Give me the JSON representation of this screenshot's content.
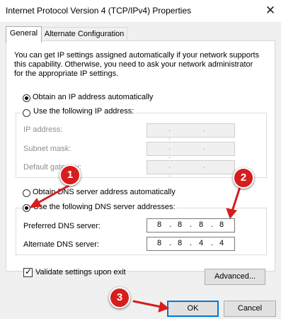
{
  "window": {
    "title": "Internet Protocol Version 4 (TCP/IPv4) Properties",
    "close_glyph": "✕"
  },
  "tabs": [
    {
      "label": "General",
      "active": true
    },
    {
      "label": "Alternate Configuration",
      "active": false
    }
  ],
  "intro_text": [
    "You can get IP settings assigned automatically if your network supports",
    "this capability. Otherwise, you need to ask your network administrator",
    "for the appropriate IP settings."
  ],
  "ip": {
    "auto_label": "Obtain an IP address automatically",
    "auto_selected": true,
    "manual_label": "Use the following IP address:",
    "manual_selected": false,
    "fields": [
      {
        "label": "IP address:",
        "value": ". . ."
      },
      {
        "label": "Subnet mask:",
        "value": ". . ."
      },
      {
        "label": "Default gateway:",
        "value": ". . ."
      }
    ]
  },
  "dns": {
    "auto_label": "Obtain DNS server address automatically",
    "auto_selected": false,
    "manual_label": "Use the following DNS server addresses:",
    "manual_selected": true,
    "preferred": {
      "label": "Preferred DNS server:",
      "octets": [
        "8",
        "8",
        "8",
        "8"
      ]
    },
    "alternate": {
      "label": "Alternate DNS server:",
      "octets": [
        "8",
        "8",
        "4",
        "4"
      ]
    }
  },
  "validate": {
    "label": "Validate settings upon exit",
    "checked": true,
    "check_glyph": "✓"
  },
  "buttons": {
    "advanced": "Advanced...",
    "ok": "OK",
    "cancel": "Cancel"
  },
  "annotations": [
    {
      "number": "1"
    },
    {
      "number": "2"
    },
    {
      "number": "3"
    }
  ],
  "colors": {
    "annotation": "#d71d1d",
    "focus": "#0078d7"
  },
  "icons": {
    "close": "close-icon",
    "check": "checkmark-icon"
  }
}
